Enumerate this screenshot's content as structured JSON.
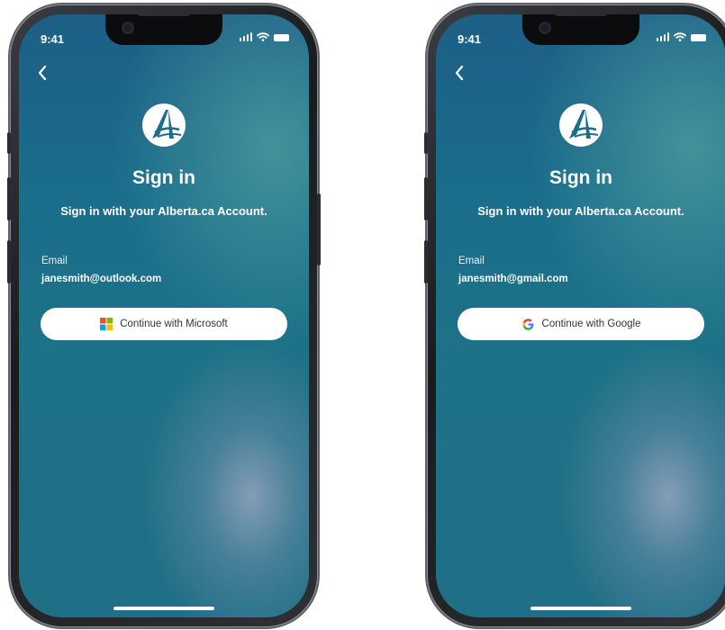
{
  "phones": [
    {
      "status_time": "9:41",
      "back_icon": "chevron-left-icon",
      "logo_icon": "alberta-logo-icon",
      "title": "Sign in",
      "subtitle": "Sign in with your Alberta.ca Account.",
      "email_label": "Email",
      "email_value": "janesmith@outlook.com",
      "button_label": "Continue with Microsoft",
      "button_icon": "microsoft-logo-icon"
    },
    {
      "status_time": "9:41",
      "back_icon": "chevron-left-icon",
      "logo_icon": "alberta-logo-icon",
      "title": "Sign in",
      "subtitle": "Sign in with your Alberta.ca Account.",
      "email_label": "Email",
      "email_value": "janesmith@gmail.com",
      "button_label": "Continue with Google",
      "button_icon": "google-logo-icon"
    }
  ],
  "colors": {
    "screen_top": "#1c5f86",
    "screen_bottom": "#1f6f86",
    "button_bg": "#ffffff",
    "text_on_screen": "#ffffff"
  }
}
